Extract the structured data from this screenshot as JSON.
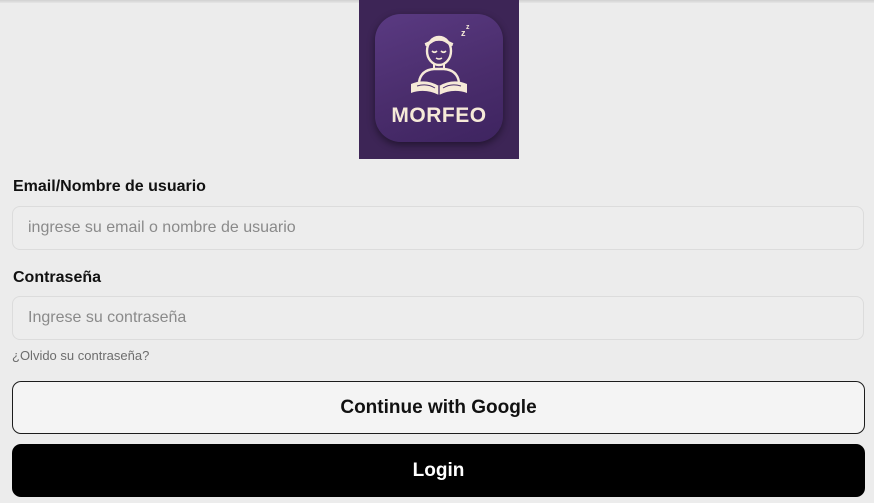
{
  "app": {
    "logo_text": "MORFEO",
    "logo_background": "#3d2556",
    "logo_tile_color": "#4a2d6c"
  },
  "form": {
    "email": {
      "label": "Email/Nombre de usuario",
      "placeholder": "ingrese su email o nombre de usuario",
      "value": ""
    },
    "password": {
      "label": "Contraseña",
      "placeholder": "Ingrese su contraseña",
      "value": ""
    },
    "forgot_link": "¿Olvido su contraseña?"
  },
  "buttons": {
    "google_label": "Continue with Google",
    "login_label": "Login"
  },
  "icons": {
    "logo": "sleeping-reader-icon"
  },
  "colors": {
    "page_background": "#ececec",
    "login_button": "#000000",
    "google_button_border": "#1c1c1c"
  }
}
